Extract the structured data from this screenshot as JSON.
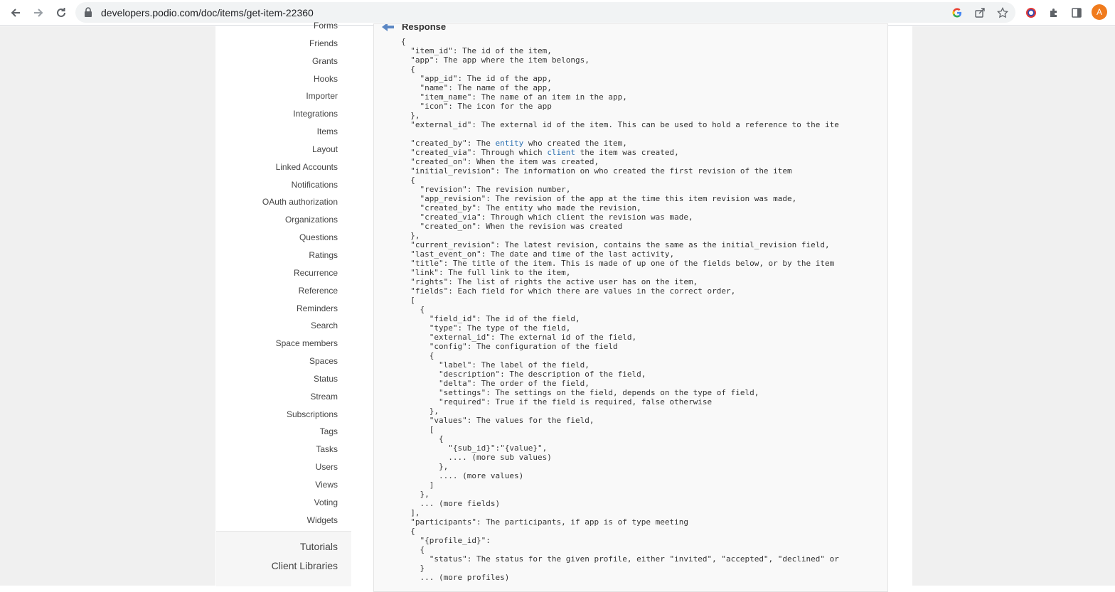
{
  "browser": {
    "url": "developers.podio.com/doc/items/get-item-22360",
    "profile_initial": "A"
  },
  "sidebar": {
    "items": [
      "Forms",
      "Friends",
      "Grants",
      "Hooks",
      "Importer",
      "Integrations",
      "Items",
      "Layout",
      "Linked Accounts",
      "Notifications",
      "OAuth authorization",
      "Organizations",
      "Questions",
      "Ratings",
      "Recurrence",
      "Reference",
      "Reminders",
      "Search",
      "Space members",
      "Spaces",
      "Status",
      "Stream",
      "Subscriptions",
      "Tags",
      "Tasks",
      "Users",
      "Views",
      "Voting",
      "Widgets"
    ],
    "tutorials": "Tutorials",
    "client_libraries": "Client Libraries"
  },
  "response": {
    "title": "Response",
    "code_lines": [
      {
        "t": "{"
      },
      {
        "t": "  \"item_id\": The id of the item,"
      },
      {
        "t": "  \"app\": The app where the item belongs,"
      },
      {
        "t": "  {"
      },
      {
        "t": "    \"app_id\": The id of the app,"
      },
      {
        "t": "    \"name\": The name of the app,"
      },
      {
        "t": "    \"item_name\": The name of an item in the app,"
      },
      {
        "t": "    \"icon\": The icon for the app"
      },
      {
        "t": "  },"
      },
      {
        "t": "  \"external_id\": The external id of the item. This can be used to hold a reference to the ite"
      },
      {
        "t": ""
      },
      {
        "t": "  \"created_by\": The ",
        "link": "entity",
        "after": " who created the item,"
      },
      {
        "t": "  \"created_via\": Through which ",
        "link": "client",
        "after": " the item was created,"
      },
      {
        "t": "  \"created_on\": When the item was created,"
      },
      {
        "t": "  \"initial_revision\": The information on who created the first revision of the item"
      },
      {
        "t": "  {"
      },
      {
        "t": "    \"revision\": The revision number,"
      },
      {
        "t": "    \"app_revision\": The revision of the app at the time this item revision was made,"
      },
      {
        "t": "    \"created_by\": The entity who made the revision,"
      },
      {
        "t": "    \"created_via\": Through which client the revision was made,"
      },
      {
        "t": "    \"created_on\": When the revision was created"
      },
      {
        "t": "  },"
      },
      {
        "t": "  \"current_revision\": The latest revision, contains the same as the initial_revision field,"
      },
      {
        "t": "  \"last_event_on\": The date and time of the last activity,"
      },
      {
        "t": "  \"title\": The title of the item. This is made of up one of the fields below, or by the item"
      },
      {
        "t": "  \"link\": The full link to the item,"
      },
      {
        "t": "  \"rights\": The list of rights the active user has on the item,"
      },
      {
        "t": "  \"fields\": Each field for which there are values in the correct order,"
      },
      {
        "t": "  ["
      },
      {
        "t": "    {"
      },
      {
        "t": "      \"field_id\": The id of the field,"
      },
      {
        "t": "      \"type\": The type of the field,"
      },
      {
        "t": "      \"external_id\": The external id of the field,"
      },
      {
        "t": "      \"config\": The configuration of the field"
      },
      {
        "t": "      {"
      },
      {
        "t": "        \"label\": The label of the field,"
      },
      {
        "t": "        \"description\": The description of the field,"
      },
      {
        "t": "        \"delta\": The order of the field,"
      },
      {
        "t": "        \"settings\": The settings on the field, depends on the type of field,"
      },
      {
        "t": "        \"required\": True if the field is required, false otherwise"
      },
      {
        "t": "      },"
      },
      {
        "t": "      \"values\": The values for the field,"
      },
      {
        "t": "      ["
      },
      {
        "t": "        {"
      },
      {
        "t": "          \"{sub_id}\":\"{value}\","
      },
      {
        "t": "          .... (more sub values)"
      },
      {
        "t": "        },"
      },
      {
        "t": "        .... (more values)"
      },
      {
        "t": "      ]"
      },
      {
        "t": "    },"
      },
      {
        "t": "    ... (more fields)"
      },
      {
        "t": "  ],"
      },
      {
        "t": "  \"participants\": The participants, if app is of type meeting"
      },
      {
        "t": "  {"
      },
      {
        "t": "    \"{profile_id}\":"
      },
      {
        "t": "    {"
      },
      {
        "t": "      \"status\": The status for the given profile, either \"invited\", \"accepted\", \"declined\" or"
      },
      {
        "t": "    }"
      },
      {
        "t": "    ... (more profiles)"
      }
    ]
  },
  "colors": {
    "link": "#2a6fb0",
    "panel": "#f9f9f9",
    "outer": "#f0f0f0",
    "avatar": "#f07b1d"
  }
}
